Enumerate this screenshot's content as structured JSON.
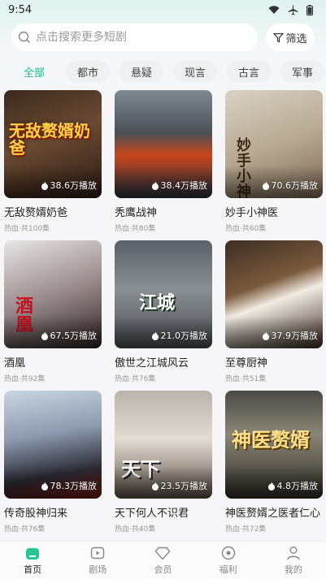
{
  "status_bar": {
    "time": "9:54",
    "icons": [
      "wifi-icon",
      "airplane-icon",
      "battery-icon"
    ]
  },
  "search": {
    "placeholder": "点击搜索更多短剧",
    "filter_label": "筛选"
  },
  "categories": [
    "全部",
    "都市",
    "悬疑",
    "现言",
    "古言",
    "军事"
  ],
  "active_category": "全部",
  "accent_color": "#20bf8f",
  "dramas": [
    {
      "title": "无敌赘婿奶爸",
      "meta": "热血·共100集",
      "plays": "38.6万播放",
      "poster_text": "无敌赘婿奶爸"
    },
    {
      "title": "秃鹰战神",
      "meta": "热血·共80集",
      "plays": "38.4万播放",
      "poster_text": ""
    },
    {
      "title": "妙手小神医",
      "meta": "热血·共60集",
      "plays": "70.6万播放",
      "poster_text": "妙手小神医"
    },
    {
      "title": "酒凰",
      "meta": "热血·共92集",
      "plays": "67.5万播放",
      "poster_text": "酒凰"
    },
    {
      "title": "傲世之江城风云",
      "meta": "热血·共76集",
      "plays": "21.0万播放",
      "poster_text": "江城"
    },
    {
      "title": "至尊厨神",
      "meta": "热血·共51集",
      "plays": "37.9万播放",
      "poster_text": ""
    },
    {
      "title": "传奇股神归来",
      "meta": "热血·共76集",
      "plays": "78.3万播放",
      "poster_text": ""
    },
    {
      "title": "天下何人不识君",
      "meta": "热血·共40集",
      "plays": "23.5万播放",
      "poster_text": "天下"
    },
    {
      "title": "神医赘婿之医者仁心",
      "meta": "热血·共72集",
      "plays": "4.8万播放",
      "poster_text": "神医赘婿"
    }
  ],
  "tabbar": {
    "items": [
      {
        "label": "首页",
        "icon": "home-icon"
      },
      {
        "label": "剧场",
        "icon": "theater-icon"
      },
      {
        "label": "会员",
        "icon": "vip-diamond-icon"
      },
      {
        "label": "福利",
        "icon": "welfare-icon"
      },
      {
        "label": "我的",
        "icon": "profile-icon"
      }
    ],
    "active": "首页"
  }
}
